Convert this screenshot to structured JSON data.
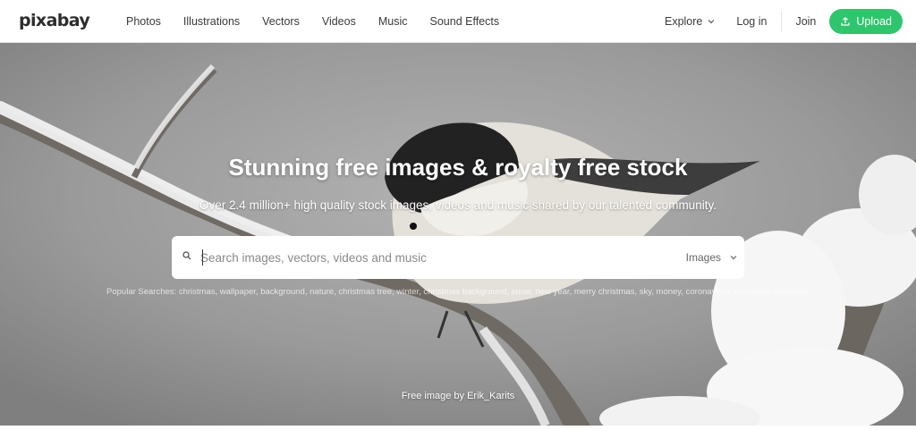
{
  "header": {
    "logo": "pixabay",
    "nav": [
      "Photos",
      "Illustrations",
      "Vectors",
      "Videos",
      "Music",
      "Sound Effects"
    ],
    "explore_label": "Explore",
    "login_label": "Log in",
    "join_label": "Join",
    "upload_label": "Upload"
  },
  "hero": {
    "title": "Stunning free images & royalty free stock",
    "subtitle": "Over 2.4 million+ high quality stock images, videos and music shared by our talented community.",
    "search": {
      "placeholder": "Search images, vectors, videos and music",
      "type_label": "Images"
    },
    "popular_prefix": "Popular Searches:",
    "popular_terms": [
      "christmas",
      "wallpaper",
      "background",
      "nature",
      "christmas tree",
      "winter",
      "christmas background",
      "snow",
      "new year",
      "merry christmas",
      "sky",
      "money",
      "coronavirus",
      "christmas wallpaper"
    ],
    "credit": "Free image by Erik_Karits"
  },
  "icons": {
    "explore_chevron": "chevron-down-icon",
    "upload": "upload-icon",
    "search": "search-icon",
    "type_chevron": "chevron-down-icon"
  },
  "colors": {
    "accent": "#2ec66d",
    "header_bg": "#ffffff",
    "hero_text": "#ffffff"
  }
}
